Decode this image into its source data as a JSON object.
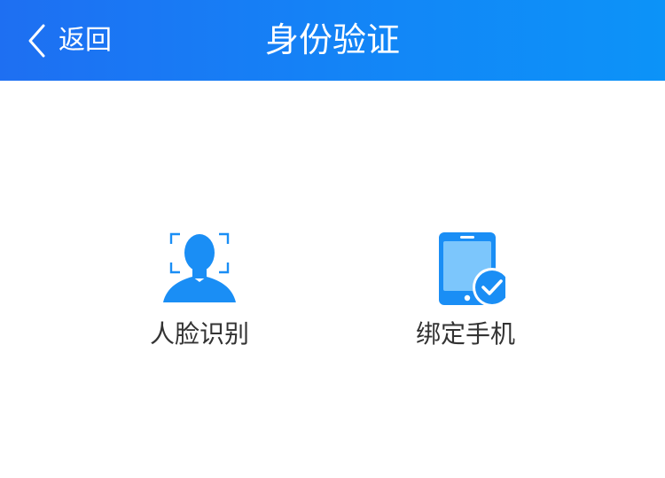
{
  "header": {
    "back_label": "返回",
    "title": "身份验证",
    "back_icon": "chevron-left-icon"
  },
  "options": [
    {
      "label": "人脸识别",
      "icon": "face-recognition-icon"
    },
    {
      "label": "绑定手机",
      "icon": "phone-verified-icon"
    }
  ],
  "colors": {
    "header_start": "#1e6ff2",
    "header_end": "#0c93f8",
    "accent_blue": "#1a8ef5",
    "light_blue": "#6fc0fb",
    "label_text": "#333333"
  }
}
